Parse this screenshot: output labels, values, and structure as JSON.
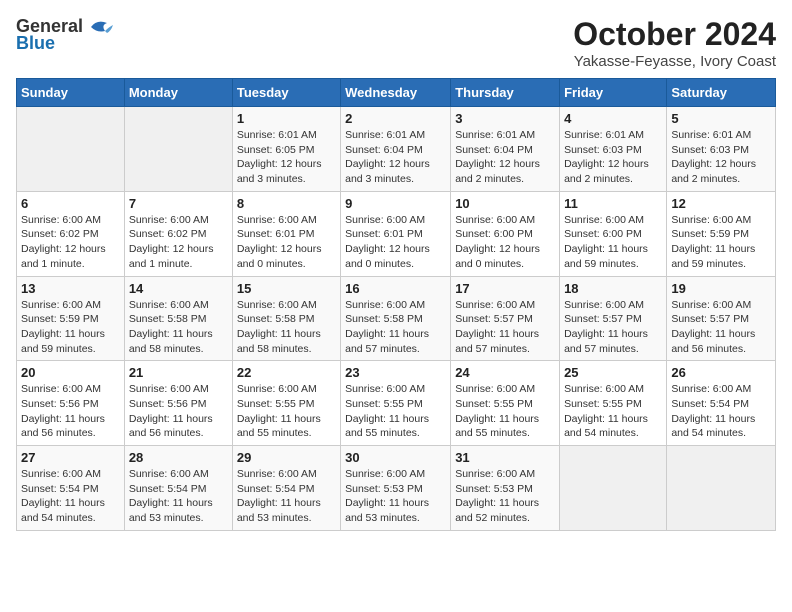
{
  "header": {
    "logo_general": "General",
    "logo_blue": "Blue",
    "month_title": "October 2024",
    "location": "Yakasse-Feyasse, Ivory Coast"
  },
  "calendar": {
    "days_of_week": [
      "Sunday",
      "Monday",
      "Tuesday",
      "Wednesday",
      "Thursday",
      "Friday",
      "Saturday"
    ],
    "weeks": [
      [
        {
          "day": "",
          "info": ""
        },
        {
          "day": "",
          "info": ""
        },
        {
          "day": "1",
          "info": "Sunrise: 6:01 AM\nSunset: 6:05 PM\nDaylight: 12 hours\nand 3 minutes."
        },
        {
          "day": "2",
          "info": "Sunrise: 6:01 AM\nSunset: 6:04 PM\nDaylight: 12 hours\nand 3 minutes."
        },
        {
          "day": "3",
          "info": "Sunrise: 6:01 AM\nSunset: 6:04 PM\nDaylight: 12 hours\nand 2 minutes."
        },
        {
          "day": "4",
          "info": "Sunrise: 6:01 AM\nSunset: 6:03 PM\nDaylight: 12 hours\nand 2 minutes."
        },
        {
          "day": "5",
          "info": "Sunrise: 6:01 AM\nSunset: 6:03 PM\nDaylight: 12 hours\nand 2 minutes."
        }
      ],
      [
        {
          "day": "6",
          "info": "Sunrise: 6:00 AM\nSunset: 6:02 PM\nDaylight: 12 hours\nand 1 minute."
        },
        {
          "day": "7",
          "info": "Sunrise: 6:00 AM\nSunset: 6:02 PM\nDaylight: 12 hours\nand 1 minute."
        },
        {
          "day": "8",
          "info": "Sunrise: 6:00 AM\nSunset: 6:01 PM\nDaylight: 12 hours\nand 0 minutes."
        },
        {
          "day": "9",
          "info": "Sunrise: 6:00 AM\nSunset: 6:01 PM\nDaylight: 12 hours\nand 0 minutes."
        },
        {
          "day": "10",
          "info": "Sunrise: 6:00 AM\nSunset: 6:00 PM\nDaylight: 12 hours\nand 0 minutes."
        },
        {
          "day": "11",
          "info": "Sunrise: 6:00 AM\nSunset: 6:00 PM\nDaylight: 11 hours\nand 59 minutes."
        },
        {
          "day": "12",
          "info": "Sunrise: 6:00 AM\nSunset: 5:59 PM\nDaylight: 11 hours\nand 59 minutes."
        }
      ],
      [
        {
          "day": "13",
          "info": "Sunrise: 6:00 AM\nSunset: 5:59 PM\nDaylight: 11 hours\nand 59 minutes."
        },
        {
          "day": "14",
          "info": "Sunrise: 6:00 AM\nSunset: 5:58 PM\nDaylight: 11 hours\nand 58 minutes."
        },
        {
          "day": "15",
          "info": "Sunrise: 6:00 AM\nSunset: 5:58 PM\nDaylight: 11 hours\nand 58 minutes."
        },
        {
          "day": "16",
          "info": "Sunrise: 6:00 AM\nSunset: 5:58 PM\nDaylight: 11 hours\nand 57 minutes."
        },
        {
          "day": "17",
          "info": "Sunrise: 6:00 AM\nSunset: 5:57 PM\nDaylight: 11 hours\nand 57 minutes."
        },
        {
          "day": "18",
          "info": "Sunrise: 6:00 AM\nSunset: 5:57 PM\nDaylight: 11 hours\nand 57 minutes."
        },
        {
          "day": "19",
          "info": "Sunrise: 6:00 AM\nSunset: 5:57 PM\nDaylight: 11 hours\nand 56 minutes."
        }
      ],
      [
        {
          "day": "20",
          "info": "Sunrise: 6:00 AM\nSunset: 5:56 PM\nDaylight: 11 hours\nand 56 minutes."
        },
        {
          "day": "21",
          "info": "Sunrise: 6:00 AM\nSunset: 5:56 PM\nDaylight: 11 hours\nand 56 minutes."
        },
        {
          "day": "22",
          "info": "Sunrise: 6:00 AM\nSunset: 5:55 PM\nDaylight: 11 hours\nand 55 minutes."
        },
        {
          "day": "23",
          "info": "Sunrise: 6:00 AM\nSunset: 5:55 PM\nDaylight: 11 hours\nand 55 minutes."
        },
        {
          "day": "24",
          "info": "Sunrise: 6:00 AM\nSunset: 5:55 PM\nDaylight: 11 hours\nand 55 minutes."
        },
        {
          "day": "25",
          "info": "Sunrise: 6:00 AM\nSunset: 5:55 PM\nDaylight: 11 hours\nand 54 minutes."
        },
        {
          "day": "26",
          "info": "Sunrise: 6:00 AM\nSunset: 5:54 PM\nDaylight: 11 hours\nand 54 minutes."
        }
      ],
      [
        {
          "day": "27",
          "info": "Sunrise: 6:00 AM\nSunset: 5:54 PM\nDaylight: 11 hours\nand 54 minutes."
        },
        {
          "day": "28",
          "info": "Sunrise: 6:00 AM\nSunset: 5:54 PM\nDaylight: 11 hours\nand 53 minutes."
        },
        {
          "day": "29",
          "info": "Sunrise: 6:00 AM\nSunset: 5:54 PM\nDaylight: 11 hours\nand 53 minutes."
        },
        {
          "day": "30",
          "info": "Sunrise: 6:00 AM\nSunset: 5:53 PM\nDaylight: 11 hours\nand 53 minutes."
        },
        {
          "day": "31",
          "info": "Sunrise: 6:00 AM\nSunset: 5:53 PM\nDaylight: 11 hours\nand 52 minutes."
        },
        {
          "day": "",
          "info": ""
        },
        {
          "day": "",
          "info": ""
        }
      ]
    ]
  }
}
